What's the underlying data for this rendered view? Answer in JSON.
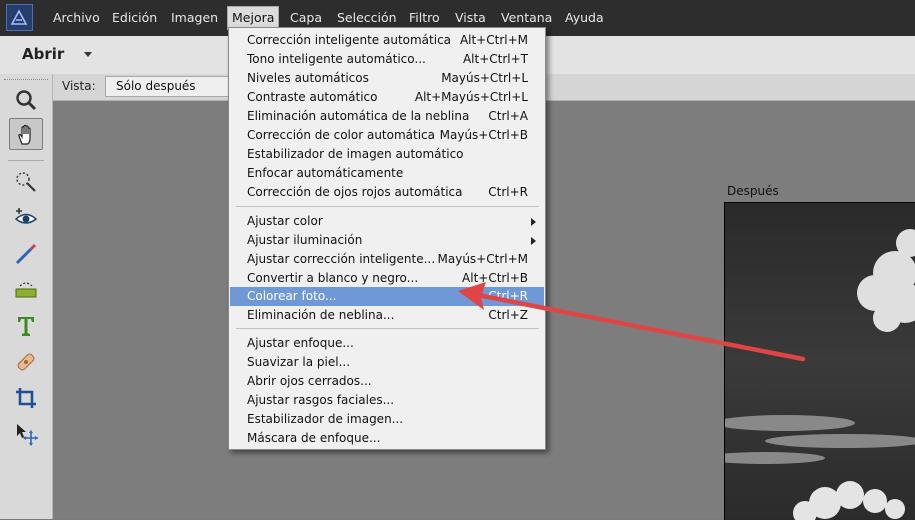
{
  "menubar": {
    "items": [
      "Archivo",
      "Edición",
      "Imagen",
      "Mejora",
      "Capa",
      "Selección",
      "Filtro",
      "Vista",
      "Ventana",
      "Ayuda"
    ],
    "active": "Mejora"
  },
  "toolbar": {
    "open_label": "Abrir"
  },
  "viewbar": {
    "label": "Vista:",
    "selected": "Sólo después"
  },
  "canvas": {
    "after_label": "Después"
  },
  "enhance_menu": {
    "items": [
      {
        "label": "Corrección inteligente automática",
        "shortcut": "Alt+Ctrl+M"
      },
      {
        "label": "Tono inteligente automático...",
        "shortcut": "Alt+Ctrl+T"
      },
      {
        "label": "Niveles automáticos",
        "shortcut": "Mayús+Ctrl+L"
      },
      {
        "label": "Contraste automático",
        "shortcut": "Alt+Mayús+Ctrl+L"
      },
      {
        "label": "Eliminación automática de la neblina",
        "shortcut": "Ctrl+A"
      },
      {
        "label": "Corrección de color automática",
        "shortcut": "Mayús+Ctrl+B"
      },
      {
        "label": "Estabilizador de imagen automático",
        "shortcut": ""
      },
      {
        "label": "Enfocar automáticamente",
        "shortcut": ""
      },
      {
        "label": "Corrección de ojos rojos automática",
        "shortcut": "Ctrl+R"
      },
      {
        "label": "Ajustar color",
        "shortcut": ""
      },
      {
        "label": "Ajustar iluminación",
        "shortcut": ""
      },
      {
        "label": "Ajustar corrección inteligente...",
        "shortcut": "Mayús+Ctrl+M"
      },
      {
        "label": "Convertir a blanco y negro...",
        "shortcut": "Alt+Ctrl+B"
      },
      {
        "label": "Colorear foto...",
        "shortcut": "Ctrl+R"
      },
      {
        "label": "Eliminación de neblina...",
        "shortcut": "Ctrl+Z"
      },
      {
        "label": "Ajustar enfoque...",
        "shortcut": ""
      },
      {
        "label": "Suavizar la piel...",
        "shortcut": ""
      },
      {
        "label": "Abrir ojos cerrados...",
        "shortcut": ""
      },
      {
        "label": "Ajustar rasgos faciales...",
        "shortcut": ""
      },
      {
        "label": "Estabilizador de imagen...",
        "shortcut": ""
      },
      {
        "label": "Máscara de enfoque...",
        "shortcut": ""
      }
    ],
    "highlighted": "Colorear foto..."
  },
  "tools": [
    "zoom-tool",
    "hand-tool",
    "quick-selection-tool",
    "red-eye-tool",
    "whiten-teeth-tool",
    "straighten-tool",
    "type-tool",
    "spot-healing-tool",
    "crop-tool",
    "move-tool"
  ],
  "colors": {
    "menubar": "#2d2d2d",
    "highlight": "#6f99d6",
    "annotation_arrow": "#e04545"
  }
}
